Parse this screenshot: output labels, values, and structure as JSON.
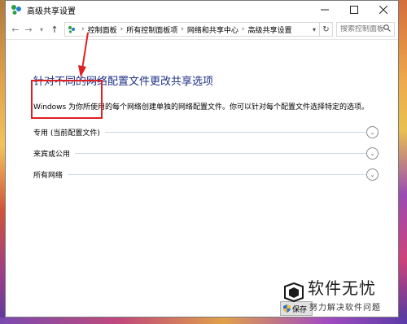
{
  "window": {
    "title": "高级共享设置"
  },
  "breadcrumb": [
    "控制面板",
    "所有控制面板项",
    "网络和共享中心",
    "高级共享设置"
  ],
  "search": {
    "placeholder": "搜索控制面板"
  },
  "main": {
    "heading": "针对不同的网络配置文件更改共享选项",
    "description": "Windows 为你所使用的每个网络创建单独的网络配置文件。你可以针对每个配置文件选择特定的选项。",
    "sections": [
      {
        "label": "专用 (当前配置文件)"
      },
      {
        "label": "来宾或公用"
      },
      {
        "label": "所有网络"
      }
    ]
  },
  "footer": {
    "save_label": "保存"
  },
  "watermark": {
    "title": "软件无忧",
    "subtitle": "努力解决软件问题"
  },
  "colors": {
    "heading": "#1e3287",
    "highlight": "#e02020"
  }
}
